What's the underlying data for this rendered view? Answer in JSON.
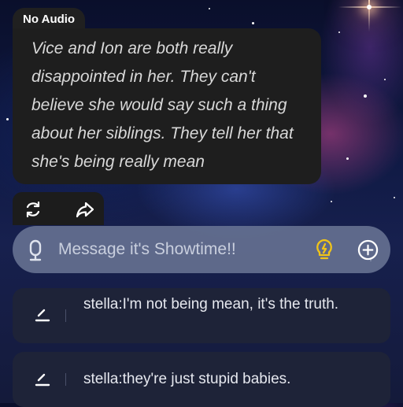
{
  "message": {
    "badge": "No Audio",
    "text": "Vice and Ion are both really disappointed in her. They can't believe she would say such a thing about her siblings. They tell her that she's being really mean"
  },
  "actions": {
    "regenerate_icon": "refresh-icon",
    "share_icon": "share-icon"
  },
  "composer": {
    "placeholder": "Message it's Showtime!!",
    "mic_icon": "microphone-icon",
    "idea_icon": "lightbulb-icon",
    "add_icon": "plus-circle-icon",
    "idea_color": "#f0c419"
  },
  "suggestions": [
    {
      "text": "stella:I'm not being mean, it's the truth.",
      "icon": "pencil-icon"
    },
    {
      "text": "stella:they're just stupid babies.",
      "icon": "pencil-icon"
    }
  ]
}
